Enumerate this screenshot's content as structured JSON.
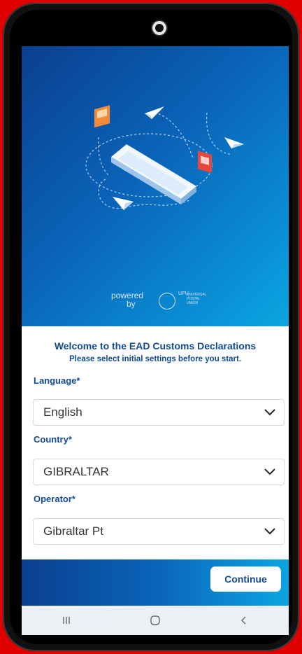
{
  "hero": {
    "powered_label": "powered",
    "by_label": "by",
    "upu_letters": "UPU",
    "upu_text": [
      "UNIVERSAL",
      "POSTAL",
      "UNION"
    ]
  },
  "form": {
    "welcome": "Welcome to the EAD Customs Declarations",
    "subtitle": "Please select initial settings before you start.",
    "language_label": "Language*",
    "language_value": "English",
    "country_label": "Country*",
    "country_value": "GIBRALTAR",
    "operator_label": "Operator*",
    "operator_value": "Gibraltar Pt"
  },
  "actions": {
    "continue_label": "Continue"
  },
  "navbar": {
    "recents_icon": "recents-icon",
    "home_icon": "home-icon",
    "back_icon": "back-icon"
  },
  "colors": {
    "brand_blue": "#124a95",
    "gradient_start": "#0b3f8f",
    "gradient_end": "#0aa6e2",
    "frame": "#e00000"
  }
}
